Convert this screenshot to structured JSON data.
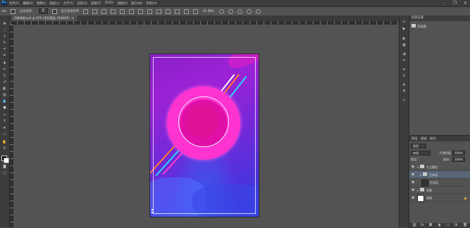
{
  "menubar": {
    "logo": "Ps",
    "menus": [
      "文件(F)",
      "编辑(E)",
      "图像(I)",
      "图层(L)",
      "文字(Y)",
      "选择(S)",
      "滤镜(T)",
      "3D(D)",
      "视图(V)",
      "窗口(W)",
      "帮助(H)"
    ],
    "window_controls": [
      "–",
      "❐",
      "✕"
    ]
  },
  "options": {
    "auto_select_label": "自动选择：",
    "auto_select_value": "组",
    "show_transform_label": "显示变换控件"
  },
  "document_tab": {
    "title": "风格海报.psd @ 25% (形状图层, RGB/8#)",
    "close": "×"
  },
  "history": {
    "tab": "历史记录",
    "items": [
      "无标题"
    ]
  },
  "layers_panel": {
    "tabs": [
      "图层",
      "通道",
      "路径"
    ],
    "kind_label": "类型",
    "blend_mode": "穿透",
    "opacity_label": "不透明度:",
    "opacity_value": "100%",
    "lock_label": "锁定:",
    "fill_label": "填充:",
    "fill_value": "100%",
    "layers": [
      {
        "name": "大主题组",
        "type": "group"
      },
      {
        "name": "主体组",
        "type": "group",
        "selected": true
      },
      {
        "name": "形状层",
        "type": "layer"
      },
      {
        "name": "背景",
        "type": "group"
      },
      {
        "name": "背景",
        "type": "layer"
      }
    ]
  },
  "colors": {
    "background": "#535353",
    "panel": "#3c3c3c",
    "accent": "#31a8ff",
    "poster_magenta": "#e00fa5",
    "poster_blue": "#2d3ce0"
  }
}
